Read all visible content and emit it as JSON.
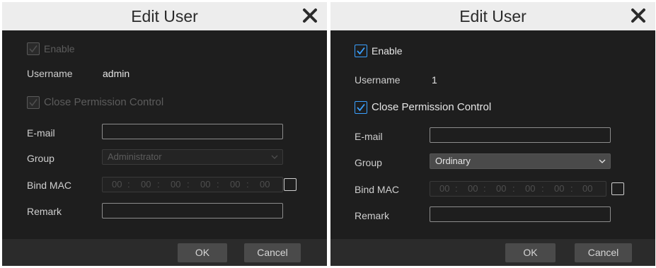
{
  "left": {
    "title": "Edit User",
    "enable_label": "Enable",
    "username_label": "Username",
    "username_value": "admin",
    "close_perm_label": "Close Permission Control",
    "email_label": "E-mail",
    "email_value": "",
    "group_label": "Group",
    "group_value": "Administrator",
    "bind_mac_label": "Bind MAC",
    "mac_octets": [
      "00",
      "00",
      "00",
      "00",
      "00",
      "00"
    ],
    "mac_sep": ":",
    "remark_label": "Remark",
    "remark_value": "",
    "ok_label": "OK",
    "cancel_label": "Cancel",
    "enable_checked": true,
    "enable_disabled": true,
    "close_perm_checked": true,
    "close_perm_disabled": true,
    "group_disabled": true,
    "bind_mac_checked": false
  },
  "right": {
    "title": "Edit User",
    "enable_label": "Enable",
    "username_label": "Username",
    "username_value": "1",
    "close_perm_label": "Close Permission Control",
    "email_label": "E-mail",
    "email_value": "",
    "group_label": "Group",
    "group_value": "Ordinary",
    "bind_mac_label": "Bind MAC",
    "mac_octets": [
      "00",
      "00",
      "00",
      "00",
      "00",
      "00"
    ],
    "mac_sep": ":",
    "remark_label": "Remark",
    "remark_value": "",
    "ok_label": "OK",
    "cancel_label": "Cancel",
    "enable_checked": true,
    "enable_disabled": false,
    "close_perm_checked": true,
    "close_perm_disabled": false,
    "group_disabled": false,
    "bind_mac_checked": false
  },
  "colors": {
    "titlebar_bg": "#ededed",
    "dialog_bg": "#1e1e1e",
    "footer_bg": "#2b2b2b",
    "accent": "#3aa0ff",
    "button_bg": "#4a4a4a"
  },
  "icons": {
    "close": "close-x-icon",
    "checkbox": "check-icon",
    "dropdown": "chevron-down-icon"
  }
}
